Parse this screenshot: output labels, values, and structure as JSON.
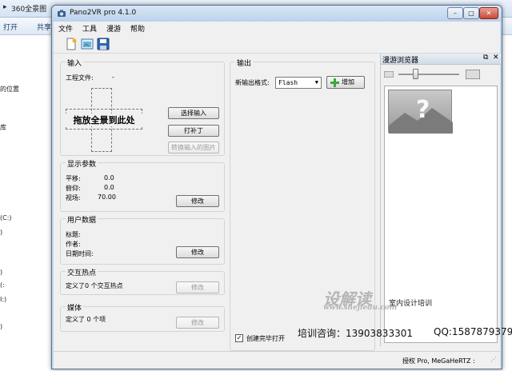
{
  "background_window": {
    "address_text": "360全景图",
    "toolbar_open": "打开",
    "toolbar_share": "共享",
    "sidebar_items": [
      "的位置",
      "库",
      "(C:)",
      ")",
      ")",
      "(:",
      "I:)",
      ")"
    ]
  },
  "window": {
    "title": "Pano2VR pro 4.1.0",
    "minimize": "–",
    "maximize": "□",
    "close": "✕"
  },
  "menu": [
    "文件",
    "工具",
    "漫游",
    "帮助"
  ],
  "toolbar_icons": [
    "new-project-icon",
    "open-project-icon",
    "save-project-icon"
  ],
  "input_group": {
    "title": "输入",
    "project_file_label": "工程文件:",
    "project_file_value": "-",
    "drop_text": "拖放全景到此处",
    "select_input_button": "选择输入",
    "patch_button": "打补丁",
    "convert_button": "转换输入的图片"
  },
  "display_group": {
    "title": "显示参数",
    "pan_label": "平移:",
    "pan_value": "0.0",
    "tilt_label": "俯仰:",
    "tilt_value": "0.0",
    "fov_label": "视场:",
    "fov_value": "70.00",
    "modify_button": "修改"
  },
  "userdata_group": {
    "title": "用户数据",
    "title_label": "标题:",
    "author_label": "作者:",
    "datetime_label": "日期时间:",
    "modify_button": "修改"
  },
  "hotspot_group": {
    "title": "交互热点",
    "summary": "定义了0 个交互热点",
    "modify_button": "修改"
  },
  "media_group": {
    "title": "媒体",
    "summary": "定义了 0 个项",
    "modify_button": "修改"
  },
  "output_group": {
    "title": "输出",
    "format_label": "新输出格式:",
    "format_value": "Flash",
    "add_button": "增加",
    "open_after_label": "创建完毕打开",
    "open_after_checked": true
  },
  "tour_browser": {
    "title": "漫游浏览器",
    "slider_value": 0.3
  },
  "status_bar": {
    "license": "授权 Pro, MeGaHeRTZ :"
  },
  "watermark": {
    "logo": "设解读",
    "url": "www.shejiedu.com",
    "tagline": "室内设计培训",
    "consult": "培训咨询：13903833301",
    "qq": "QQ:1587879379"
  },
  "colors": {
    "title_bar": "#c6daee",
    "window_face": "#f0f0f0",
    "add_icon": "#3aa83a"
  }
}
